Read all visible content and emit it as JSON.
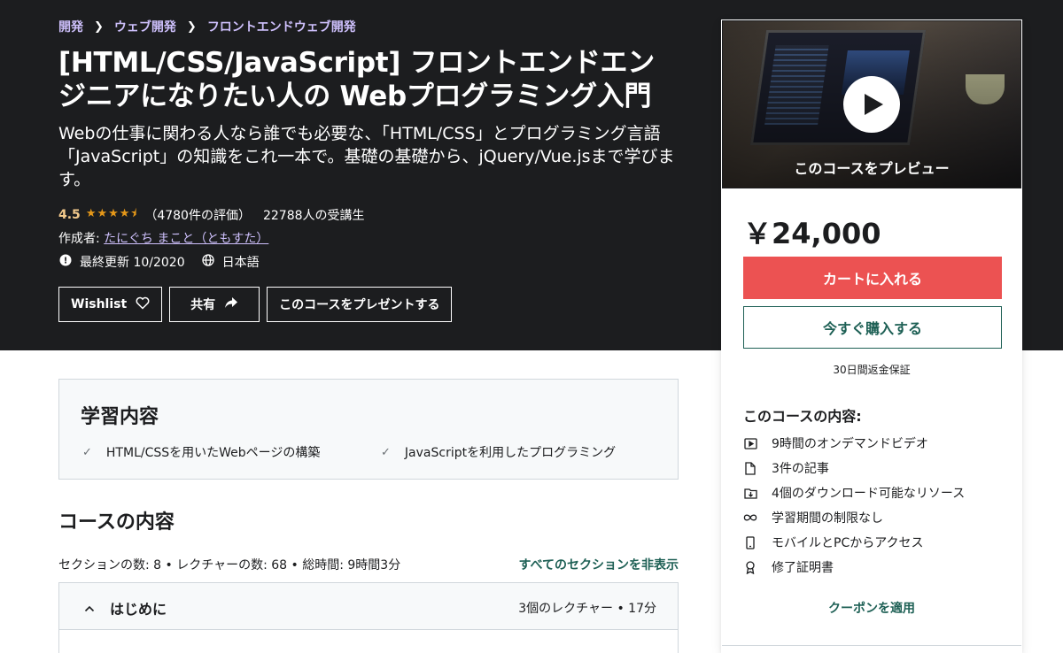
{
  "breadcrumb": [
    "開発",
    "ウェブ開発",
    "フロントエンドウェブ開発"
  ],
  "course": {
    "title": "[HTML/CSS/JavaScript] フロントエンドエンジニアになりたい人の Webプログラミング入門",
    "subtitle": "Webの仕事に関わる人なら誰でも必要な、「HTML/CSS」とプログラミング言語「JavaScript」の知識をこれ一本で。基礎の基礎から、jQuery/Vue.jsまで学びます。",
    "rating": "4.5",
    "rating_stars": 4.5,
    "rating_count": "（4780件の評価）",
    "students": "22788人の受講生",
    "author_label": "作成者:",
    "author_name": "たにぐち まこと（ともすた）",
    "last_updated": "最終更新 10/2020",
    "language": "日本語"
  },
  "actions": {
    "wishlist": "Wishlist",
    "share": "共有",
    "gift": "このコースをプレゼントする"
  },
  "sidebar": {
    "preview_label": "このコースをプレビュー",
    "price": "￥24,000",
    "add_to_cart": "カートに入れる",
    "buy_now": "今すぐ購入する",
    "guarantee": "30日間返金保証",
    "includes_title": "このコースの内容:",
    "includes": [
      {
        "icon": "video-icon",
        "label": "9時間のオンデマンドビデオ"
      },
      {
        "icon": "file-icon",
        "label": "3件の記事"
      },
      {
        "icon": "download-folder-icon",
        "label": "4個のダウンロード可能なリソース"
      },
      {
        "icon": "infinity-icon",
        "label": "学習期間の制限なし"
      },
      {
        "icon": "mobile-icon",
        "label": "モバイルとPCからアクセス"
      },
      {
        "icon": "certificate-icon",
        "label": "修了証明書"
      }
    ],
    "coupon": "クーポンを適用"
  },
  "learn": {
    "title": "学習内容",
    "items": [
      "HTML/CSSを用いたWebページの構築",
      "JavaScriptを利用したプログラミング"
    ]
  },
  "content": {
    "title": "コースの内容",
    "meta": "セクションの数: 8 • レクチャーの数: 68 • 総時間: 9時間3分",
    "toggle_all": "すべてのセクションを非表示",
    "sections": [
      {
        "title": "はじめに",
        "meta": "3個のレクチャー • 17分"
      }
    ]
  },
  "colors": {
    "hero_bg": "#1c1d1f",
    "link_purple": "#cec0fc",
    "rating_orange": "#f3ca8c",
    "cart_red": "#ec5252",
    "teal": "#1e6055"
  }
}
